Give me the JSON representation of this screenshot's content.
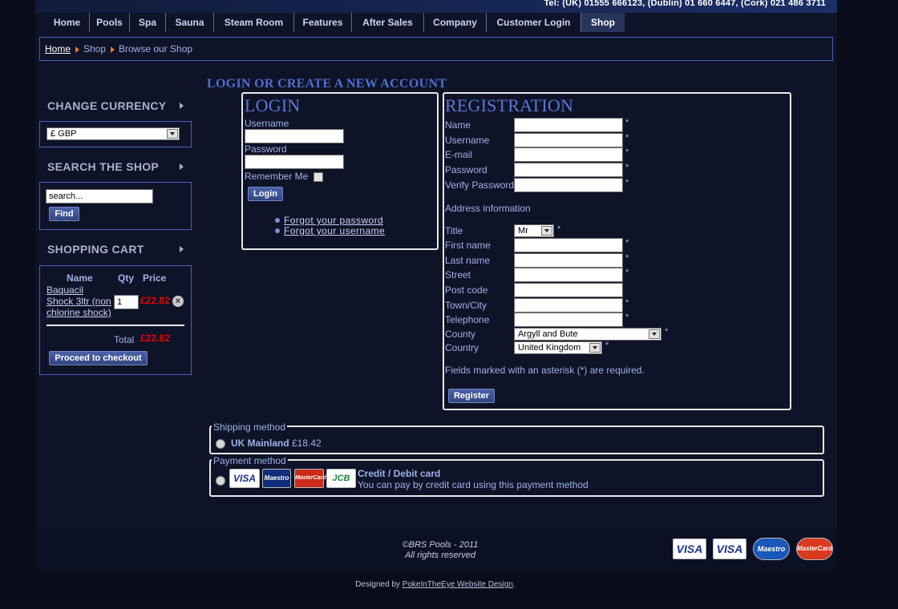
{
  "header": {
    "tel": "Tel: (UK) 01555 666123, (Dublin) 01 660 6447, (Cork) 021 486 3711"
  },
  "nav": {
    "items": [
      "Home",
      "Pools",
      "Spa",
      "Sauna",
      "Steam Room",
      "Features",
      "After Sales",
      "Company",
      "Customer Login",
      "Shop"
    ]
  },
  "breadcrumb": {
    "home": "Home",
    "shop": "Shop",
    "current": "Browse our Shop"
  },
  "sidebar": {
    "currency_heading": "CHANGE CURRENCY",
    "currency_selected": "£ GBP",
    "search_heading": "SEARCH THE SHOP",
    "search_value": "search...",
    "find_label": "Find",
    "cart_heading": "SHOPPING CART",
    "cart_col_name": "Name",
    "cart_col_qty": "Qty",
    "cart_col_price": "Price",
    "cart_item_line1": "Baquacil",
    "cart_item_line2": "Shock 3ltr (non",
    "cart_item_line3": "chlorine shock)",
    "cart_item_qty": "1",
    "cart_item_price": "£22.82",
    "total_label": "Total",
    "total_value": "£22.82",
    "checkout_label": "Proceed to checkout"
  },
  "main": {
    "heading": "LOGIN OR CREATE A NEW ACCOUNT",
    "login": {
      "title": "LOGIN",
      "username_label": "Username",
      "password_label": "Password",
      "remember_label": "Remember Me",
      "login_button": "Login",
      "forgot_password": "Forgot your password",
      "forgot_username": "Forgot your username"
    },
    "registration": {
      "title": "REGISTRATION",
      "name": "Name",
      "username": "Username",
      "email": "E-mail",
      "password": "Password",
      "verify_password": "Verify Password",
      "address_info": "Address information",
      "title_label": "Title",
      "title_value": "Mr",
      "first_name": "First name",
      "last_name": "Last name",
      "street": "Street",
      "post_code": "Post code",
      "town_city": "Town/City",
      "telephone": "Telephone",
      "county": "County",
      "county_value": "Argyll and Bute",
      "country": "Country",
      "country_value": "United Kingdom",
      "required_note": "Fields marked with an asterisk (*) are required.",
      "register_button": "Register",
      "asterisk": "*"
    },
    "shipping": {
      "legend": "Shipping method",
      "option_name": "UK Mainland",
      "option_price": "£18.42"
    },
    "payment": {
      "legend": "Payment method",
      "option_name": "Credit / Debit card",
      "option_desc": "You can pay by credit card using this payment method",
      "cards": [
        "VISA",
        "Maestro",
        "MasterCard",
        "JCB"
      ]
    }
  },
  "footer": {
    "copyright": "©BRS Pools - 2011",
    "rights": "All rights reserved",
    "cards": [
      "VISA",
      "VISA",
      "Maestro",
      "MasterCard"
    ],
    "designed_prefix": "Designed by",
    "designed_link": "PokeInTheEye Website Design",
    "designed_suffix": "."
  }
}
